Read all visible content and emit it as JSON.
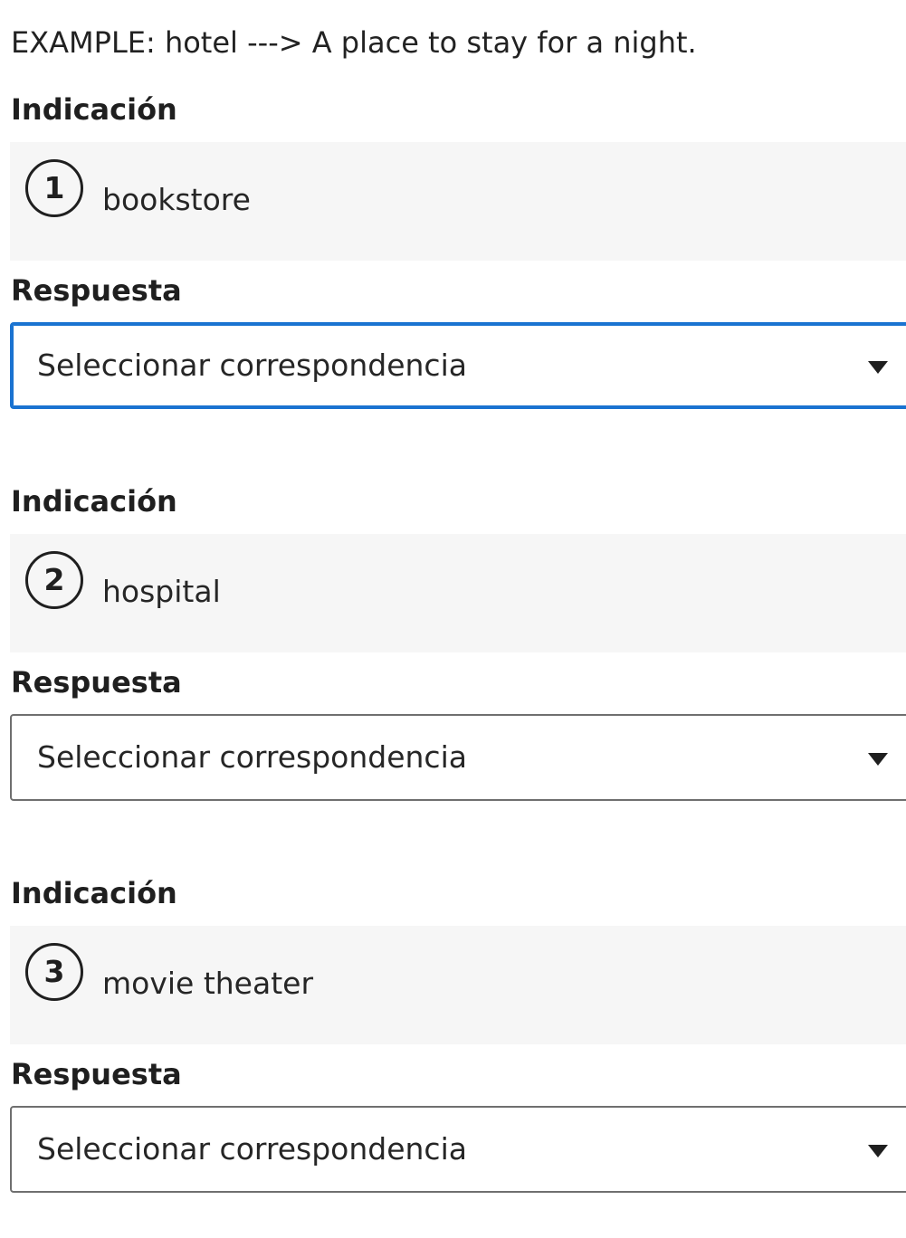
{
  "example": "EXAMPLE: hotel ---> A place to stay for a night.",
  "items": [
    {
      "prompt_label": "Indicación",
      "number": "1",
      "prompt": "bookstore",
      "answer_label": "Respuesta",
      "answer_value": "Seleccionar correspondencia"
    },
    {
      "prompt_label": "Indicación",
      "number": "2",
      "prompt": "hospital",
      "answer_label": "Respuesta",
      "answer_value": "Seleccionar correspondencia"
    },
    {
      "prompt_label": "Indicación",
      "number": "3",
      "prompt": "movie theater",
      "answer_label": "Respuesta",
      "answer_value": "Seleccionar correspondencia"
    }
  ],
  "colors": {
    "focus_border": "#1a73d1",
    "prompt_background": "#f6f6f6",
    "select_border": "#6f6f6f"
  },
  "icons": {
    "dropdown": "chevron-down-icon"
  }
}
